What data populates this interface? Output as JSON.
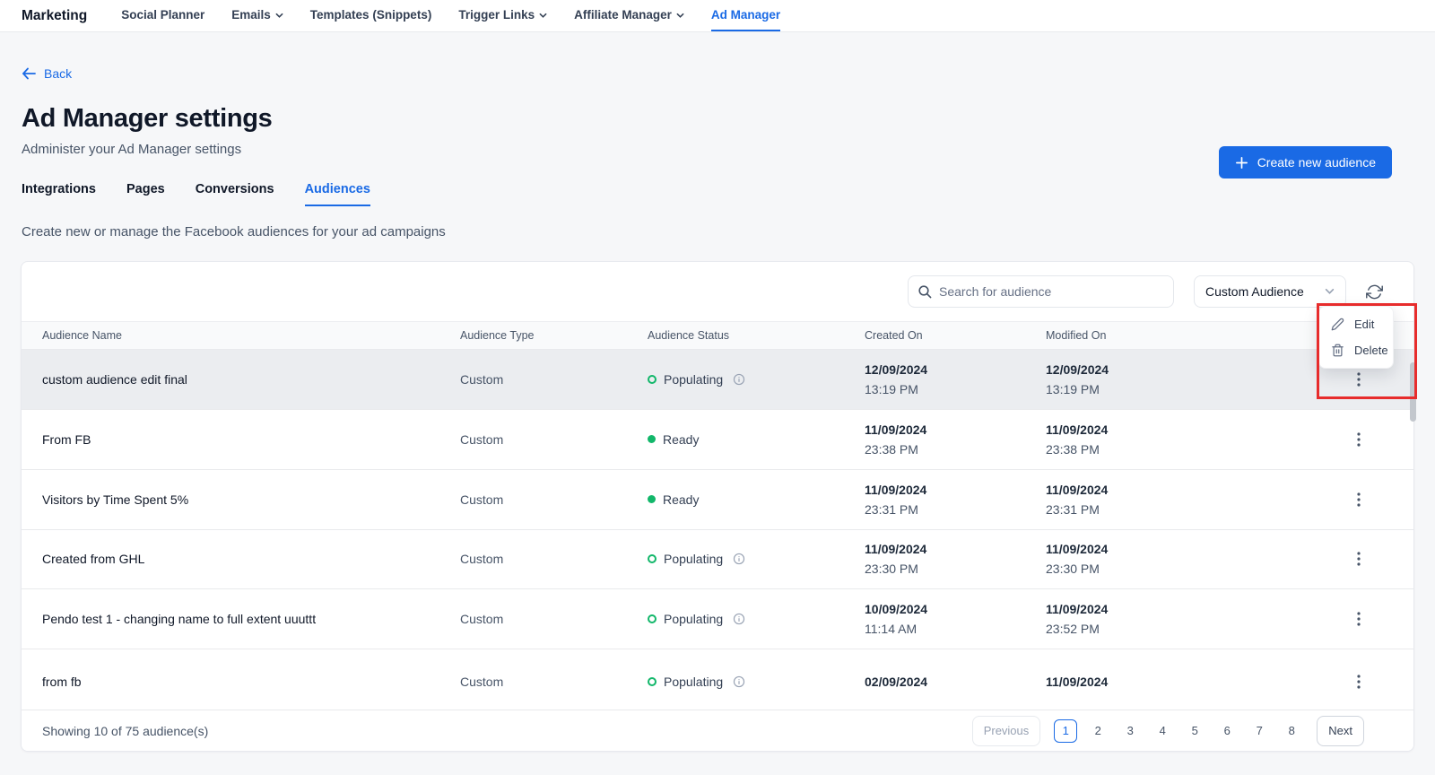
{
  "topnav": {
    "brand": "Marketing",
    "items": [
      {
        "label": "Social Planner",
        "dropdown": false,
        "active": false
      },
      {
        "label": "Emails",
        "dropdown": true,
        "active": false
      },
      {
        "label": "Templates (Snippets)",
        "dropdown": false,
        "active": false
      },
      {
        "label": "Trigger Links",
        "dropdown": true,
        "active": false
      },
      {
        "label": "Affiliate Manager",
        "dropdown": true,
        "active": false
      },
      {
        "label": "Ad Manager",
        "dropdown": false,
        "active": true
      }
    ]
  },
  "header": {
    "back_label": "Back",
    "title": "Ad Manager settings",
    "subtitle": "Administer your Ad Manager settings",
    "create_button_label": "Create new audience"
  },
  "tabs": [
    {
      "label": "Integrations",
      "active": false
    },
    {
      "label": "Pages",
      "active": false
    },
    {
      "label": "Conversions",
      "active": false
    },
    {
      "label": "Audiences",
      "active": true
    }
  ],
  "description": "Create new or manage the Facebook audiences for your ad campaigns",
  "toolbar": {
    "search_placeholder": "Search for audience",
    "filter_value": "Custom Audience"
  },
  "context_menu": {
    "items": [
      {
        "label": "Edit",
        "icon": "pencil-icon"
      },
      {
        "label": "Delete",
        "icon": "trash-icon"
      }
    ]
  },
  "table": {
    "columns": [
      "Audience Name",
      "Audience Type",
      "Audience Status",
      "Created On",
      "Modified On"
    ],
    "rows": [
      {
        "name": "custom audience edit final",
        "type": "Custom",
        "status": "Populating",
        "status_kind": "populating",
        "info_icon": true,
        "created_date": "12/09/2024",
        "created_time": "13:19 PM",
        "modified_date": "12/09/2024",
        "modified_time": "13:19 PM",
        "highlighted": true
      },
      {
        "name": "From FB",
        "type": "Custom",
        "status": "Ready",
        "status_kind": "ready",
        "info_icon": false,
        "created_date": "11/09/2024",
        "created_time": "23:38 PM",
        "modified_date": "11/09/2024",
        "modified_time": "23:38 PM",
        "highlighted": false
      },
      {
        "name": "Visitors by Time Spent 5%",
        "type": "Custom",
        "status": "Ready",
        "status_kind": "ready",
        "info_icon": false,
        "created_date": "11/09/2024",
        "created_time": "23:31 PM",
        "modified_date": "11/09/2024",
        "modified_time": "23:31 PM",
        "highlighted": false
      },
      {
        "name": "Created from GHL",
        "type": "Custom",
        "status": "Populating",
        "status_kind": "populating",
        "info_icon": true,
        "created_date": "11/09/2024",
        "created_time": "23:30 PM",
        "modified_date": "11/09/2024",
        "modified_time": "23:30 PM",
        "highlighted": false
      },
      {
        "name": "Pendo test 1 - changing name to full extent uuuttt",
        "type": "Custom",
        "status": "Populating",
        "status_kind": "populating",
        "info_icon": true,
        "created_date": "10/09/2024",
        "created_time": "11:14 AM",
        "modified_date": "11/09/2024",
        "modified_time": "23:52 PM",
        "highlighted": false
      },
      {
        "name": "from fb",
        "type": "Custom",
        "status": "Populating",
        "status_kind": "populating",
        "info_icon": true,
        "created_date": "02/09/2024",
        "created_time": "",
        "modified_date": "11/09/2024",
        "modified_time": "",
        "highlighted": false,
        "clipped": true
      }
    ]
  },
  "footer": {
    "showing_text": "Showing 10 of 75 audience(s)",
    "previous_label": "Previous",
    "pages": [
      "1",
      "2",
      "3",
      "4",
      "5",
      "6",
      "7",
      "8"
    ],
    "active_page": "1",
    "next_label": "Next"
  },
  "colors": {
    "accent": "#1a6ae5",
    "ready_green": "#12b76a",
    "annotation_red": "#e72c2c"
  },
  "icons": [
    "arrow-left-icon",
    "plus-icon",
    "search-icon",
    "chevron-down-icon",
    "refresh-icon",
    "pencil-icon",
    "trash-icon",
    "info-icon",
    "kebab-icon",
    "status-dot"
  ]
}
